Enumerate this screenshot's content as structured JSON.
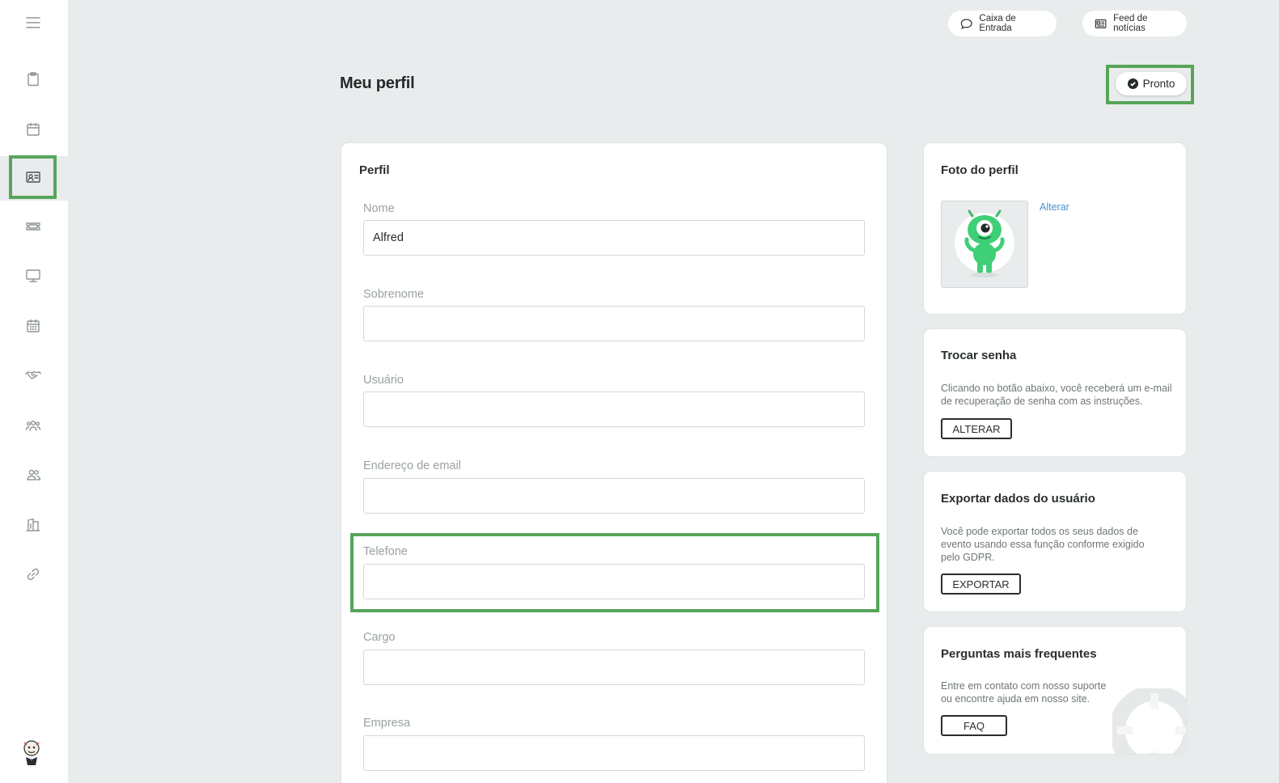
{
  "header": {
    "inbox_label": "Caixa de Entrada",
    "news_label": "Feed de notícias"
  },
  "page": {
    "title": "Meu perfil",
    "done_label": "Pronto"
  },
  "sidebar": {
    "items": [
      {
        "icon": "clipboard-icon"
      },
      {
        "icon": "calendar-icon"
      },
      {
        "icon": "profile-card-icon",
        "active": true
      },
      {
        "icon": "ticket-icon"
      },
      {
        "icon": "monitor-icon"
      },
      {
        "icon": "schedule-icon"
      },
      {
        "icon": "handshake-icon"
      },
      {
        "icon": "group-icon"
      },
      {
        "icon": "users-icon"
      },
      {
        "icon": "building-icon"
      },
      {
        "icon": "link-icon"
      }
    ]
  },
  "profile": {
    "title": "Perfil",
    "fields": [
      {
        "label": "Nome",
        "value": "Alfred"
      },
      {
        "label": "Sobrenome",
        "value": ""
      },
      {
        "label": "Usuário",
        "value": ""
      },
      {
        "label": "Endereço de email",
        "value": ""
      },
      {
        "label": "Telefone",
        "value": ""
      },
      {
        "label": "Cargo",
        "value": ""
      },
      {
        "label": "Empresa",
        "value": ""
      }
    ]
  },
  "photo": {
    "title": "Foto do perfil",
    "change_label": "Alterar"
  },
  "password": {
    "title": "Trocar senha",
    "description": "Clicando no botão abaixo, você receberá um e-mail de recuperação de senha com as instruções.",
    "button": "ALTERAR"
  },
  "export": {
    "title": "Exportar dados do usuário",
    "description": "Você pode exportar todos os seus dados de evento usando essa função conforme exigido pelo GDPR.",
    "button": "EXPORTAR"
  },
  "faq": {
    "title": "Perguntas mais frequentes",
    "description": "Entre em contato com nosso suporte ou encontre ajuda em nosso site.",
    "button": "FAQ"
  },
  "colors": {
    "accent_green": "#57a55a",
    "background": "#e9ecec",
    "link_blue": "#4a8fd6"
  }
}
